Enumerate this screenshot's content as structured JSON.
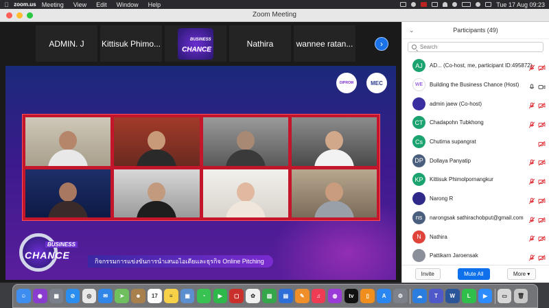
{
  "menubar": {
    "app": "zoom.us",
    "items": [
      "Meeting",
      "View",
      "Edit",
      "Window",
      "Help"
    ],
    "datetime": "Tue 17 Aug  09:23"
  },
  "window": {
    "title": "Zoom Meeting"
  },
  "thumbnails": [
    {
      "name": "ADMIN. J"
    },
    {
      "name": "Kittisuk Phimo..."
    },
    {
      "name": ""
    },
    {
      "name": "Nathira"
    },
    {
      "name": "wannee ratan..."
    }
  ],
  "share": {
    "caption": "กิจกรรมการแข่งขันการนำเสนอไอเดียและธุรกิจ Online Pitching",
    "brand_line1": "BUSINESS",
    "brand_line2": "CHANCE",
    "logo1": "DIPROM",
    "logo2": "MEC"
  },
  "panel": {
    "title": "Participants (49)",
    "search_placeholder": "Search",
    "participants": [
      {
        "initials": "AJ",
        "name": "AD...     (Co-host, me, participant ID:495872)",
        "color": "#1aa36f",
        "mic": "muted",
        "cam": "off"
      },
      {
        "initials": "WE",
        "name": "Building the Business Chance (Host)",
        "color": "#ffffff",
        "mic": "on",
        "cam": "on"
      },
      {
        "initials": "",
        "name": "admin jaew (Co-host)",
        "color": "#3a2fa0",
        "mic": "muted",
        "cam": "off"
      },
      {
        "initials": "CT",
        "name": "Chadapohn Tubkhong",
        "color": "#1aa36f",
        "mic": "muted",
        "cam": "off"
      },
      {
        "initials": "Cs",
        "name": "Chutima supangrat",
        "color": "#1aa36f",
        "mic": "none",
        "cam": "off"
      },
      {
        "initials": "DP",
        "name": "Dollaya Panyatip",
        "color": "#4a5e7d",
        "mic": "muted",
        "cam": "off"
      },
      {
        "initials": "KP",
        "name": "Kittisuk Phimolpornangkur",
        "color": "#1aa36f",
        "mic": "muted",
        "cam": "off"
      },
      {
        "initials": "",
        "name": "Narong R",
        "color": "#2f2a8a",
        "mic": "muted",
        "cam": "off"
      },
      {
        "initials": "ns",
        "name": "narongsak sathirachobput@gmail.com",
        "color": "#4a5e7d",
        "mic": "muted",
        "cam": "off"
      },
      {
        "initials": "N",
        "name": "Nathira",
        "color": "#e0433a",
        "mic": "muted",
        "cam": "off"
      },
      {
        "initials": "",
        "name": "Pattikarn Jaroensak",
        "color": "#8a8f99",
        "mic": "muted",
        "cam": "off"
      }
    ],
    "footer": {
      "invite": "Invite",
      "mute_all": "Mute All",
      "more": "More"
    }
  },
  "dock": {
    "apps": [
      {
        "name": "Finder",
        "color": "#3d8ef0",
        "glyph": "☺"
      },
      {
        "name": "Siri",
        "color": "#8a3bd0",
        "glyph": "◉"
      },
      {
        "name": "Launchpad",
        "color": "#7a7f8c",
        "glyph": "▦"
      },
      {
        "name": "Safari",
        "color": "#2a8ef0",
        "glyph": "⊘"
      },
      {
        "name": "Chrome",
        "color": "#e8e8e8",
        "glyph": "◎"
      },
      {
        "name": "Mail",
        "color": "#2f86e8",
        "glyph": "✉"
      },
      {
        "name": "Maps",
        "color": "#6fbf5f",
        "glyph": "➤"
      },
      {
        "name": "Contacts",
        "color": "#a7804d",
        "glyph": "☻"
      },
      {
        "name": "Calendar",
        "color": "#ffffff",
        "glyph": "17"
      },
      {
        "name": "Notes",
        "color": "#f7d249",
        "glyph": "≡"
      },
      {
        "name": "Preview",
        "color": "#5b8fd0",
        "glyph": "▣"
      },
      {
        "name": "Messages",
        "color": "#38c251",
        "glyph": "◔"
      },
      {
        "name": "FaceTime",
        "color": "#2fb84a",
        "glyph": "▶"
      },
      {
        "name": "Photo Booth",
        "color": "#c9302c",
        "glyph": "▢"
      },
      {
        "name": "Photos",
        "color": "#f0f0f0",
        "glyph": "✿"
      },
      {
        "name": "Numbers",
        "color": "#35a64a",
        "glyph": "▥"
      },
      {
        "name": "Keynote",
        "color": "#2d6ed8",
        "glyph": "▤"
      },
      {
        "name": "Pages",
        "color": "#f08f2a",
        "glyph": "✎"
      },
      {
        "name": "Music",
        "color": "#f03b55",
        "glyph": "♫"
      },
      {
        "name": "Podcasts",
        "color": "#9a3ad8",
        "glyph": "◍"
      },
      {
        "name": "TV",
        "color": "#111111",
        "glyph": "tv"
      },
      {
        "name": "Books",
        "color": "#f08f1e",
        "glyph": "▯"
      },
      {
        "name": "App Store",
        "color": "#2a86f0",
        "glyph": "A"
      },
      {
        "name": "System Preferences",
        "color": "#7d8189",
        "glyph": "⚙"
      },
      {
        "name": "sep",
        "color": "",
        "glyph": ""
      },
      {
        "name": "iCloud",
        "color": "#2b7de0",
        "glyph": "☁"
      },
      {
        "name": "Teams",
        "color": "#5059c9",
        "glyph": "T"
      },
      {
        "name": "Word",
        "color": "#2b579a",
        "glyph": "W"
      },
      {
        "name": "LINE",
        "color": "#2fbf4a",
        "glyph": "L"
      },
      {
        "name": "Zoom",
        "color": "#2d8cff",
        "glyph": "▶"
      },
      {
        "name": "sep",
        "color": "",
        "glyph": ""
      },
      {
        "name": "Photo Window",
        "color": "#d8d8d8",
        "glyph": "▭"
      },
      {
        "name": "Trash",
        "color": "#c8c8c8",
        "glyph": "🗑"
      }
    ]
  }
}
